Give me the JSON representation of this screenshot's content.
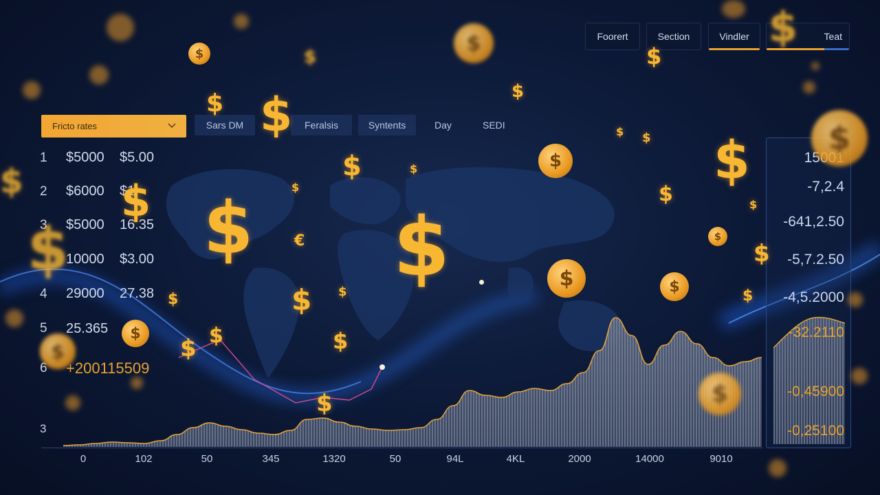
{
  "top_tabs": [
    {
      "label": "Foorert",
      "active": false
    },
    {
      "label": "Section",
      "active": false
    },
    {
      "label": "Vindler",
      "active": true
    },
    {
      "label": "Teat",
      "active": true
    }
  ],
  "filters": {
    "dropdown_label": "Fricto rates",
    "buttons": [
      "Sars DM",
      "Feralsis",
      "Syntents",
      "Day",
      "SEDI"
    ]
  },
  "table": {
    "rows": [
      {
        "idx": "1",
        "a": "$5000",
        "b": "$5.00"
      },
      {
        "idx": "2",
        "a": "$6000",
        "b": "$1"
      },
      {
        "idx": "3",
        "a": "$5000",
        "b": "16.35"
      },
      {
        "idx": "",
        "a": "10000",
        "b": "$3.00"
      },
      {
        "idx": "4",
        "a": "29000",
        "b": "27.38"
      },
      {
        "idx": "5",
        "a": "25.365",
        "b": ""
      }
    ],
    "total_idx": "6",
    "total_value": "+200115509",
    "footer_idx": "3"
  },
  "right_panel": {
    "values": [
      "15001",
      "-7,2.4",
      "-641,2.50",
      "-5,7.2.50",
      "-4,5.2000",
      "-32.2110",
      "-0,45900",
      "-0,25100"
    ]
  },
  "chart_data": {
    "type": "area",
    "x_ticks": [
      "0",
      "102",
      "50",
      "345",
      "1320",
      "50",
      "94L",
      "4KL",
      "2000",
      "14000",
      "9010"
    ],
    "series": [
      {
        "values": [
          2,
          3,
          5,
          7,
          6,
          5,
          9,
          18,
          28,
          35,
          30,
          25,
          20,
          18,
          24,
          40,
          42,
          36,
          30,
          26,
          24,
          25,
          28,
          40,
          60,
          82,
          75,
          72,
          80,
          85,
          82,
          92,
          108,
          140,
          188,
          162,
          120,
          148,
          168,
          150,
          130,
          118,
          124,
          130
        ]
      }
    ],
    "line_overlay": [
      {
        "x": 260,
        "y": 520
      },
      {
        "x": 320,
        "y": 494
      },
      {
        "x": 370,
        "y": 552
      },
      {
        "x": 430,
        "y": 586
      },
      {
        "x": 470,
        "y": 578
      },
      {
        "x": 508,
        "y": 582
      },
      {
        "x": 540,
        "y": 566
      },
      {
        "x": 556,
        "y": 534
      }
    ],
    "colors": {
      "fill": "#6b7488",
      "line": "#e1a23a",
      "overlay": "#d74a8a"
    }
  },
  "colors": {
    "accent": "#f2a633",
    "coin": "#f7b733",
    "panel_border": "#2a4a86"
  }
}
